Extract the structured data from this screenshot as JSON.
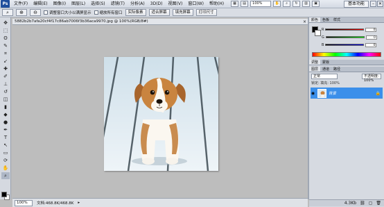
{
  "app": {
    "logo": "Ps"
  },
  "menu": {
    "items": [
      "文件(F)",
      "编辑(E)",
      "图像(I)",
      "图层(L)",
      "选择(S)",
      "滤镜(T)",
      "分析(A)",
      "3D(D)",
      "视图(V)",
      "窗口(W)",
      "帮助(H)"
    ],
    "zoom": "100%",
    "workspace": "基本功能"
  },
  "options_bar": {
    "checkbox_resize": "调整窗口大小以满屏显示",
    "checkbox_all_windows": "缩放所有窗口",
    "btn_actual": "实际像素",
    "btn_fit": "适合屏幕",
    "btn_fill": "填充屏幕",
    "btn_print": "打印尺寸"
  },
  "document": {
    "tab_title": "5882b2b7afa20cf4f17c86ab7006f3b36aca9970.jpg @ 100%(RGB/8#)",
    "status_zoom": "100%",
    "status_doc": "文档:468.8K/468.8K"
  },
  "panels": {
    "color_tabs": [
      "颜色",
      "色板",
      "样式"
    ],
    "color_values": {
      "r": "0",
      "g": "0",
      "b": "0"
    },
    "adjust_tabs": [
      "调整",
      "蒙版"
    ],
    "layers_tabs": [
      "图层",
      "通道",
      "路径"
    ],
    "blend_mode": "正常",
    "opacity": "不透明度: 100%",
    "lock_fill": "锁定:  填充: 100%",
    "layer_name": "背景",
    "footer_right": "4.3Kb"
  },
  "colors": {
    "accent": "#3b8fea",
    "panel": "#d6dae1"
  }
}
